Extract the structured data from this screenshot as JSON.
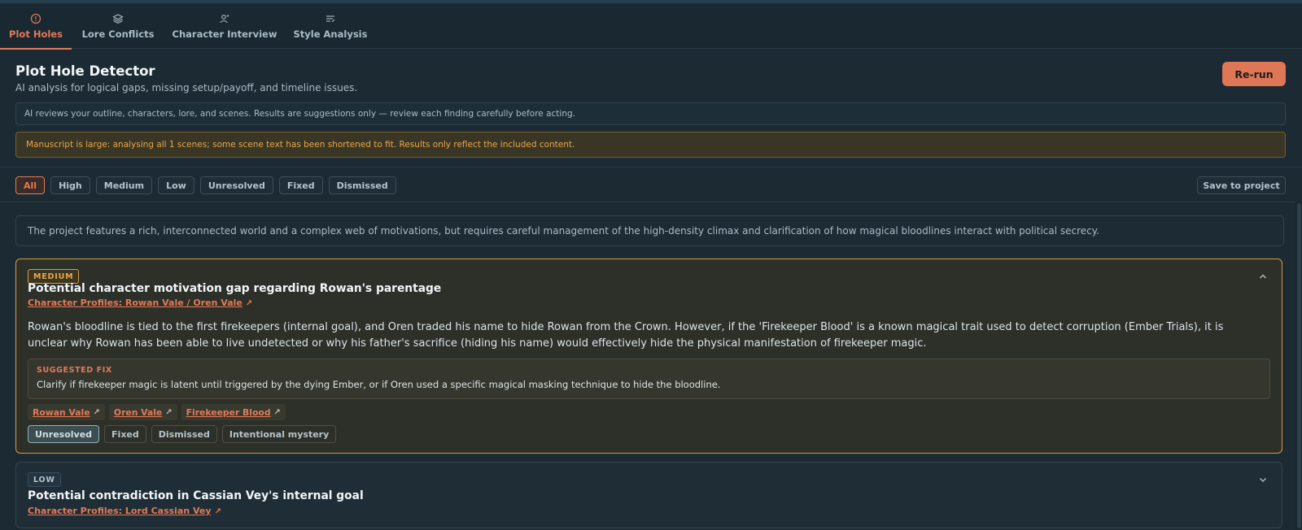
{
  "tabs": [
    {
      "label": "Plot Holes",
      "icon": "alert-circle-icon",
      "active": true
    },
    {
      "label": "Lore Conflicts",
      "icon": "layers-icon"
    },
    {
      "label": "Character Interview",
      "icon": "user-sparkle-icon"
    },
    {
      "label": "Style Analysis",
      "icon": "text-lines-icon"
    }
  ],
  "header": {
    "title": "Plot Hole Detector",
    "subtitle": "AI analysis for logical gaps, missing setup/payoff, and timeline issues.",
    "rerun_label": "Re-run"
  },
  "notice": "AI reviews your outline, characters, lore, and scenes. Results are suggestions only — review each finding carefully before acting.",
  "warning": "Manuscript is large: analysing all 1 scenes; some scene text has been shortened to fit. Results only reflect the included content.",
  "filters": [
    "All",
    "High",
    "Medium",
    "Low",
    "Unresolved",
    "Fixed",
    "Dismissed"
  ],
  "active_filter": "All",
  "save_label": "Save to project",
  "summary": "The project features a rich, interconnected world and a complex web of motivations, but requires careful management of the high-density climax and clarification of how magical bloodlines interact with political secrecy.",
  "findings": [
    {
      "severity": "MEDIUM",
      "title": "Potential character motivation gap regarding Rowan's parentage",
      "reference": "Character Profiles: Rowan Vale / Oren Vale",
      "description": "Rowan's bloodline is tied to the first firekeepers (internal goal), and Oren traded his name to hide Rowan from the Crown. However, if the 'Firekeeper Blood' is a known magical trait used to detect corruption (Ember Trials), it is unclear why Rowan has been able to live undetected or why his father's sacrifice (hiding his name) would effectively hide the physical manifestation of firekeeper magic.",
      "fix_label": "SUGGESTED FIX",
      "fix": "Clarify if firekeeper magic is latent until triggered by the dying Ember, or if Oren used a specific magical masking technique to hide the bloodline.",
      "tags": [
        "Rowan Vale",
        "Oren Vale",
        "Firekeeper Blood"
      ],
      "statuses": [
        "Unresolved",
        "Fixed",
        "Dismissed",
        "Intentional mystery"
      ],
      "active_status": "Unresolved",
      "expanded": true
    },
    {
      "severity": "LOW",
      "title": "Potential contradiction in Cassian Vey's internal goal",
      "reference": "Character Profiles: Lord Cassian Vey",
      "expanded": false
    }
  ],
  "colors": {
    "accent": "#e27a58",
    "medium": "#d49a3c",
    "background": "#1b2a33"
  }
}
